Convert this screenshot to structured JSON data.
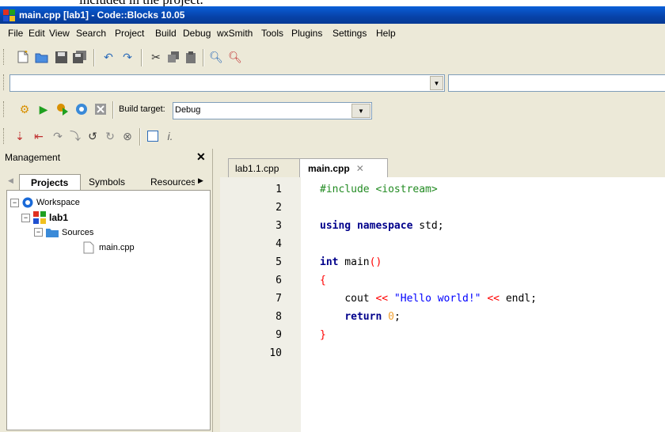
{
  "top_clipped_text": "included in the project.",
  "window": {
    "title": "main.cpp [lab1] - Code::Blocks 10.05"
  },
  "menu": [
    "File",
    "Edit",
    "View",
    "Search",
    "Project",
    "Build",
    "Debug",
    "wxSmith",
    "Tools",
    "Plugins",
    "Settings",
    "Help"
  ],
  "toolbar": {
    "build_target_label": "Build target:",
    "build_target_value": "Debug",
    "search_value": ""
  },
  "management": {
    "title": "Management",
    "tabs": [
      "Projects",
      "Symbols",
      "Resources"
    ],
    "tree": {
      "workspace": "Workspace",
      "project": "lab1",
      "folder": "Sources",
      "file": "main.cpp"
    }
  },
  "editor": {
    "tabs": [
      "lab1.1.cpp",
      "main.cpp"
    ],
    "active_tab": "main.cpp",
    "line_numbers": [
      "1",
      "2",
      "3",
      "4",
      "5",
      "6",
      "7",
      "8",
      "9",
      "10"
    ],
    "code": {
      "l1": "#include <iostream>",
      "l3_kw": "using namespace",
      "l3_rest": " std;",
      "l5_kw": "int",
      "l5_rest": " main",
      "l5_paren": "()",
      "l6": "{",
      "l7_indent": "    ",
      "l7_a": "cout ",
      "l7_op1": "<<",
      "l7_str": " \"Hello world!\" ",
      "l7_op2": "<<",
      "l7_b": " endl;",
      "l8_indent": "    ",
      "l8_kw": "return",
      "l8_sp": " ",
      "l8_num": "0",
      "l8_semi": ";",
      "l9": "}"
    }
  }
}
